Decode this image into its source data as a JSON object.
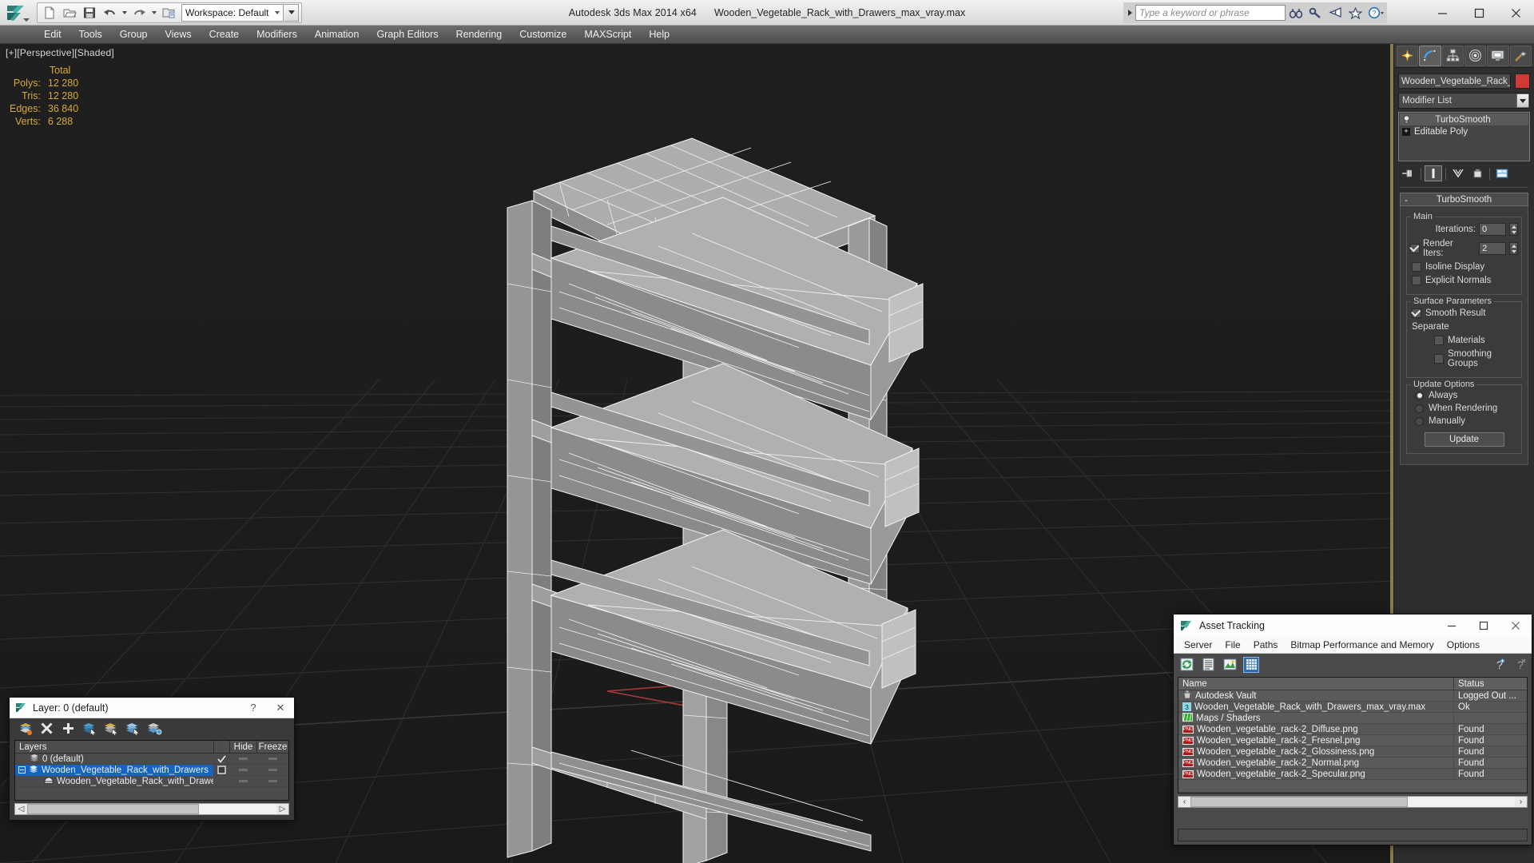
{
  "titlebar": {
    "workspace_label": "Workspace: Default",
    "app_title": "Autodesk 3ds Max  2014 x64",
    "file_title": "Wooden_Vegetable_Rack_with_Drawers_max_vray.max",
    "search_placeholder": "Type a keyword or phrase",
    "minimize": "—",
    "maximize": "☐",
    "close": "✕"
  },
  "menubar": {
    "items": [
      "Edit",
      "Tools",
      "Group",
      "Views",
      "Create",
      "Modifiers",
      "Animation",
      "Graph Editors",
      "Rendering",
      "Customize",
      "MAXScript",
      "Help"
    ]
  },
  "viewport": {
    "label": "[+][Perspective][Shaded]",
    "stats": {
      "header": "Total",
      "rows": [
        {
          "label": "Polys:",
          "value": "12 280"
        },
        {
          "label": "Tris:",
          "value": "12 280"
        },
        {
          "label": "Edges:",
          "value": "36 840"
        },
        {
          "label": "Verts:",
          "value": "6 288"
        }
      ]
    }
  },
  "command_panel": {
    "object_name": "Wooden_Vegetable_Rack_wit",
    "object_color": "#cf3a34",
    "modifier_list_label": "Modifier List",
    "modifier_stack": [
      {
        "label": "TurboSmooth",
        "selected": true
      },
      {
        "label": "Editable Poly",
        "selected": false
      }
    ],
    "turbosmooth": {
      "rollout_title": "TurboSmooth",
      "collapse_glyph": "-",
      "main_group": "Main",
      "iterations_label": "Iterations:",
      "iterations_value": "0",
      "render_iters_label": "Render Iters:",
      "render_iters_value": "2",
      "render_iters_checked": true,
      "isoline_display_label": "Isoline Display",
      "isoline_display_checked": false,
      "explicit_normals_label": "Explicit Normals",
      "explicit_normals_checked": false,
      "surface_params_group": "Surface Parameters",
      "smooth_result_label": "Smooth Result",
      "smooth_result_checked": true,
      "separate_label": "Separate",
      "materials_label": "Materials",
      "materials_checked": false,
      "smoothing_groups_label": "Smoothing Groups",
      "smoothing_groups_checked": false,
      "update_options_group": "Update Options",
      "always_label": "Always",
      "when_rendering_label": "When Rendering",
      "manually_label": "Manually",
      "update_mode": "Always",
      "update_button": "Update"
    }
  },
  "layer_dialog": {
    "title": "Layer: 0 (default)",
    "help_glyph": "?",
    "close_glyph": "✕",
    "columns": {
      "name": "Layers",
      "hide": "Hide",
      "freeze": "Freeze"
    },
    "rows": [
      {
        "label": "0 (default)",
        "indent": 1,
        "selected": false,
        "current": true
      },
      {
        "label": "Wooden_Vegetable_Rack_with_Drawers",
        "indent": 0,
        "selected": true,
        "current": false
      },
      {
        "label": "Wooden_Vegetable_Rack_with_Drawers",
        "indent": 2,
        "selected": false,
        "current": false
      }
    ]
  },
  "asset_tracking": {
    "title": "Asset Tracking",
    "minimize": "—",
    "maximize": "☐",
    "close": "✕",
    "menu": [
      "Server",
      "File",
      "Paths",
      "Bitmap Performance and Memory",
      "Options"
    ],
    "columns": {
      "name": "Name",
      "status": "Status"
    },
    "rows": [
      {
        "label": "Autodesk Vault",
        "status": "Logged Out ...",
        "indent": 1,
        "icon": "vault-icon"
      },
      {
        "label": "Wooden_Vegetable_Rack_with_Drawers_max_vray.max",
        "status": "Ok",
        "indent": 2,
        "icon": "scene-icon"
      },
      {
        "label": "Maps / Shaders",
        "status": "",
        "indent": 2,
        "icon": "maps-icon"
      },
      {
        "label": "Wooden_vegetable_rack-2_Diffuse.png",
        "status": "Found",
        "indent": 3,
        "icon": "png-icon"
      },
      {
        "label": "Wooden_vegetable_rack-2_Fresnel.png",
        "status": "Found",
        "indent": 3,
        "icon": "png-icon"
      },
      {
        "label": "Wooden_vegetable_rack-2_Glossiness.png",
        "status": "Found",
        "indent": 3,
        "icon": "png-icon"
      },
      {
        "label": "Wooden_vegetable_rack-2_Normal.png",
        "status": "Found",
        "indent": 3,
        "icon": "png-icon"
      },
      {
        "label": "Wooden_vegetable_rack-2_Specular.png",
        "status": "Found",
        "indent": 3,
        "icon": "png-icon"
      }
    ],
    "scroll_left": "‹",
    "scroll_right": "›"
  }
}
